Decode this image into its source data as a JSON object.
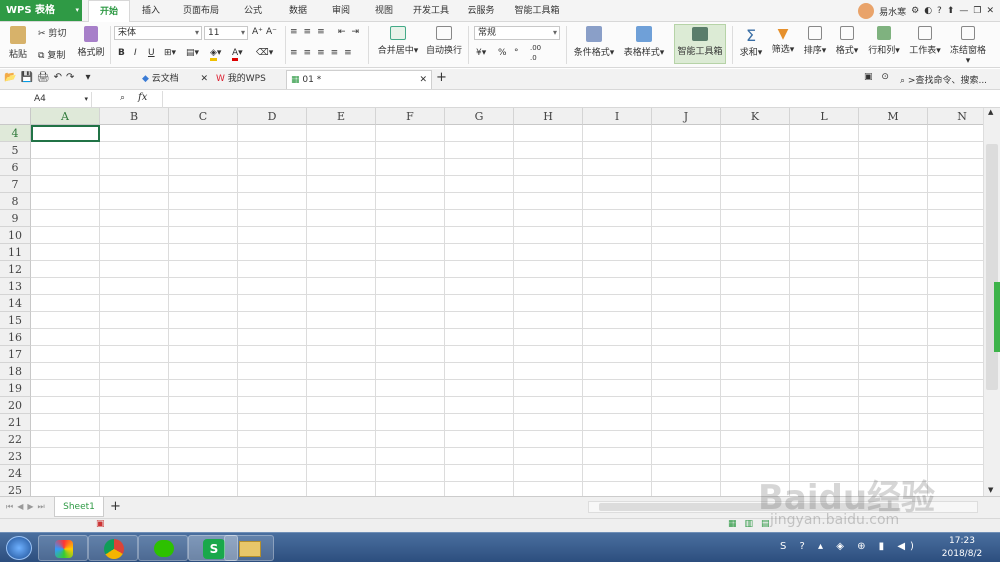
{
  "app": {
    "name": "WPS 表格",
    "user": "易水寒"
  },
  "menu_tabs": [
    "开始",
    "插入",
    "页面布局",
    "公式",
    "数据",
    "审阅",
    "视图",
    "开发工具",
    "云服务",
    "智能工具箱"
  ],
  "ribbon": {
    "paste": "粘贴",
    "cut": "剪切",
    "copy": "复制",
    "format_painter": "格式刷",
    "font_name": "宋体",
    "font_size": "11",
    "bold": "B",
    "italic": "I",
    "underline": "U",
    "merge_center": "合并居中",
    "wrap_text": "自动换行",
    "number_format": "常规",
    "percent": "%",
    "comma": "°",
    "dec_inc": ".00",
    "dec_dec": ".0",
    "cond_format": "条件格式",
    "table_style": "表格样式",
    "smart_toolbox": "智能工具箱",
    "sum": "求和",
    "filter": "筛选",
    "sort": "排序",
    "format": "格式",
    "row_col": "行和列",
    "worksheet": "工作表",
    "freeze": "冻结窗格"
  },
  "doc_tabs": [
    "云文档",
    "我的WPS",
    "01 *"
  ],
  "search_placeholder": "查找命令、搜索...",
  "formula": {
    "cell_ref": "A4",
    "fx": "fx"
  },
  "columns": [
    "A",
    "B",
    "C",
    "D",
    "E",
    "F",
    "G",
    "H",
    "I",
    "J",
    "K",
    "L",
    "M",
    "N"
  ],
  "rows": [
    "4",
    "5",
    "6",
    "7",
    "8",
    "9",
    "10",
    "11",
    "12",
    "13",
    "14",
    "15",
    "16",
    "17",
    "18",
    "19",
    "20",
    "21",
    "22",
    "23",
    "24",
    "25"
  ],
  "sheet": {
    "name": "Sheet1",
    "add": "+"
  },
  "taskbar": {
    "time": "17:23",
    "date": "2018/8/2"
  },
  "watermark": "Baidu经验",
  "watermark_sub": "jingyan.baidu.com",
  "colors": {
    "accent": "#2f9a45",
    "taskbar": "#2c4e7e"
  }
}
